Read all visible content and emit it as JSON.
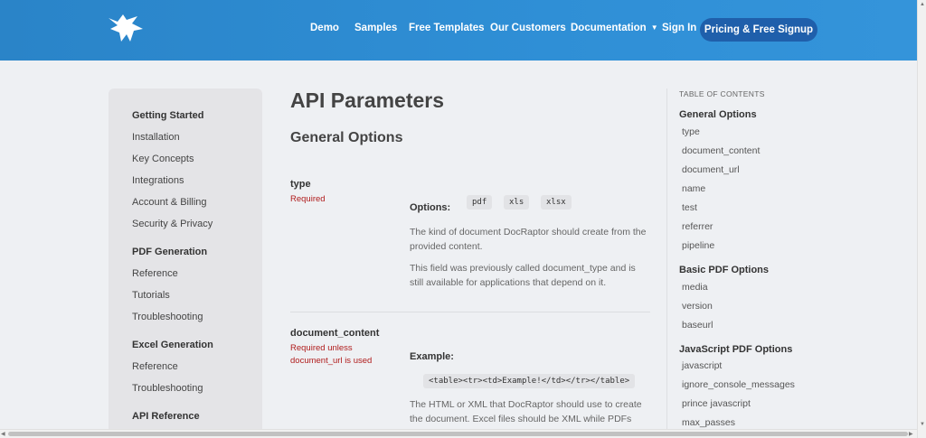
{
  "header": {
    "nav": [
      "Demo",
      "Samples",
      "Free Templates",
      "Our Customers",
      "Documentation",
      "Sign In"
    ],
    "cta": "Pricing & Free Signup"
  },
  "sidebar": {
    "items": [
      {
        "label": "Getting Started",
        "head": true
      },
      {
        "label": "Installation"
      },
      {
        "label": "Key Concepts"
      },
      {
        "label": "Integrations"
      },
      {
        "label": "Account & Billing"
      },
      {
        "label": "Security & Privacy"
      },
      {
        "label": "PDF Generation",
        "head": true
      },
      {
        "label": "Reference"
      },
      {
        "label": "Tutorials"
      },
      {
        "label": "Troubleshooting"
      },
      {
        "label": "Excel Generation",
        "head": true
      },
      {
        "label": "Reference"
      },
      {
        "label": "Troubleshooting"
      },
      {
        "label": "API Reference",
        "head": true
      }
    ]
  },
  "main": {
    "title": "API Parameters",
    "section": "General Options",
    "params": [
      {
        "name": "type",
        "required": "Required",
        "label": "Options:",
        "codes": [
          "pdf",
          "xls",
          "xlsx"
        ],
        "paras": [
          "The kind of document DocRaptor should create from the provided content.",
          "This field was previously called document_type and is still available for applications that depend on it."
        ]
      },
      {
        "name": "document_content",
        "required": "Required unless document_url is used",
        "label": "Example:",
        "codes": [
          "<table><tr><td>Example!</td></tr></table>"
        ],
        "paras": [
          "The HTML or XML that DocRaptor should use to create the document. Excel files should be XML while PDFs can be"
        ]
      }
    ]
  },
  "toc": {
    "caption": "TABLE OF CONTENTS",
    "entries": [
      {
        "label": "General Options",
        "group": true
      },
      {
        "label": "type"
      },
      {
        "label": "document_content"
      },
      {
        "label": "document_url"
      },
      {
        "label": "name"
      },
      {
        "label": "test"
      },
      {
        "label": "referrer"
      },
      {
        "label": "pipeline"
      },
      {
        "label": "Basic PDF Options",
        "group": true
      },
      {
        "label": "media"
      },
      {
        "label": "version"
      },
      {
        "label": "baseurl"
      },
      {
        "label": "JavaScript PDF Options",
        "group": true
      },
      {
        "label": "javascript"
      },
      {
        "label": "ignore_console_messages"
      },
      {
        "label": "prince javascript"
      },
      {
        "label": "max_passes"
      }
    ]
  },
  "colors": {
    "header": "#2a84c8",
    "cta": "#1f5fab",
    "required": "#b01c1c"
  }
}
